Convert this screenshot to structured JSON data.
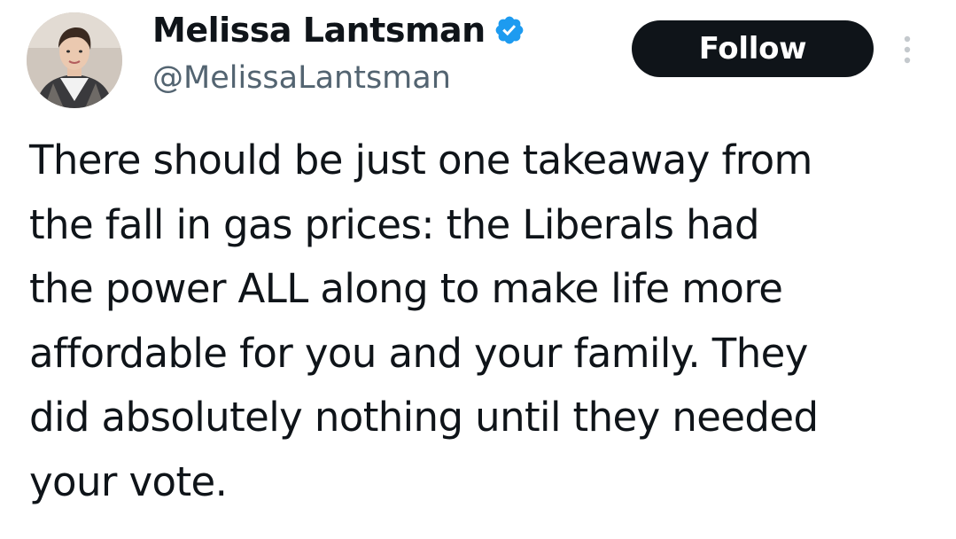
{
  "author": {
    "display_name": "Melissa Lantsman",
    "handle": "@MelissaLantsman",
    "verified": true,
    "verified_color": "#1d9bf0"
  },
  "actions": {
    "follow_label": "Follow",
    "more_icon": "more-vertical-icon"
  },
  "tweet": {
    "lines": [
      "There should be just one takeaway from",
      "the fall in gas prices: the Liberals had",
      "the power ALL along to make life more",
      "affordable for you and your family. They",
      "did absolutely nothing until they needed",
      "your vote."
    ]
  },
  "colors": {
    "text": "#0f1419",
    "secondary_text": "#536471",
    "button_bg": "#0f1419",
    "button_text": "#ffffff"
  }
}
